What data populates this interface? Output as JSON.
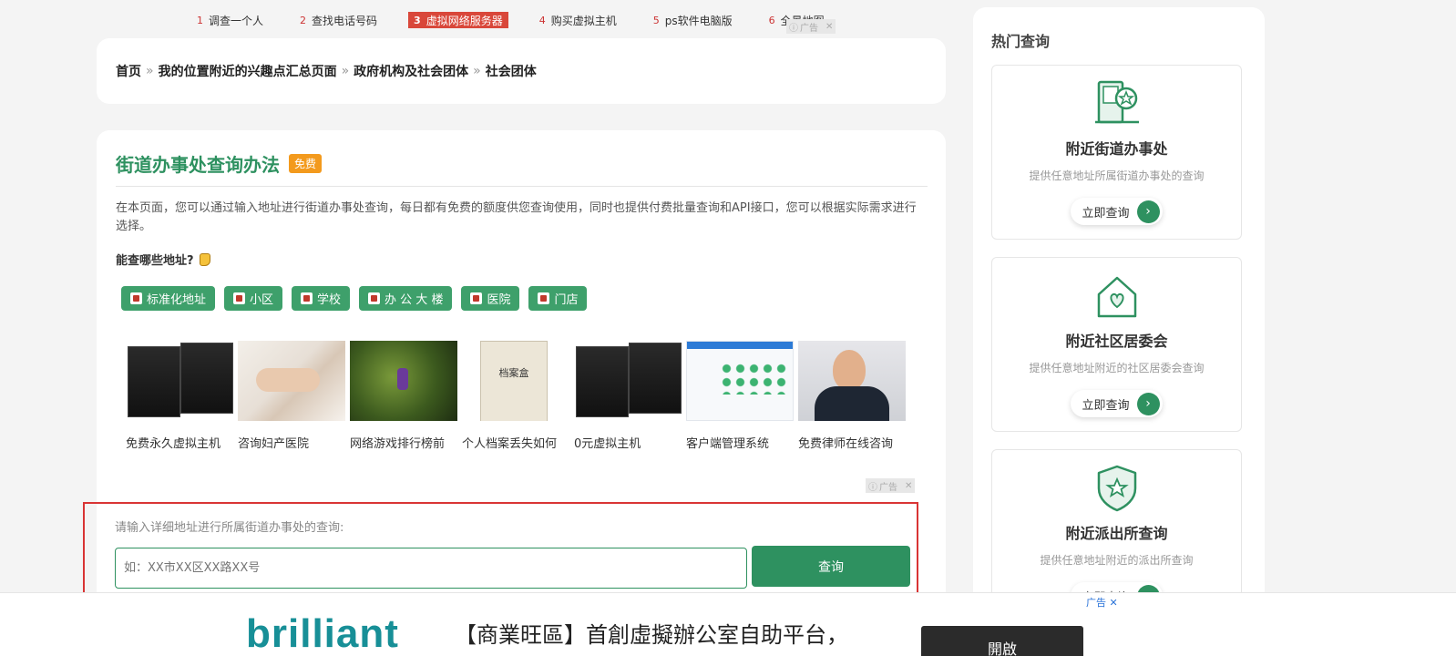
{
  "top_links": [
    {
      "num": "1",
      "label": "调查一个人"
    },
    {
      "num": "2",
      "label": "查找电话号码"
    },
    {
      "num": "3",
      "label": "虚拟网络服务器"
    },
    {
      "num": "4",
      "label": "购买虚拟主机"
    },
    {
      "num": "5",
      "label": "ps软件电脑版"
    },
    {
      "num": "6",
      "label": "全景地图"
    }
  ],
  "ad_tag": {
    "label": "广告",
    "close": "✕"
  },
  "breadcrumb": {
    "items": [
      "首页",
      "我的位置附近的兴趣点汇总页面",
      "政府机构及社会团体",
      "社会团体"
    ],
    "separator": "»"
  },
  "main": {
    "title": "街道办事处查询办法",
    "badge": "免费",
    "description": "在本页面，您可以通过输入地址进行街道办事处查询，每日都有免费的额度供您查询使用，同时也提供付费批量查询和API接口，您可以根据实际需求进行选择。",
    "subheading": "能查哪些地址?",
    "tags": [
      "标准化地址",
      "小区",
      "学校",
      "办 公 大 楼",
      "医院",
      "门店"
    ],
    "ads": [
      {
        "caption": "免费永久虚拟主机",
        "image": "server"
      },
      {
        "caption": "咨询妇产医院",
        "image": "bed"
      },
      {
        "caption": "网络游戏排行榜前",
        "image": "game"
      },
      {
        "caption": "个人档案丢失如何",
        "image": "folder"
      },
      {
        "caption": "0元虚拟主机",
        "image": "server"
      },
      {
        "caption": "客户端管理系统",
        "image": "app"
      },
      {
        "caption": "免费律师在线咨询",
        "image": "lawyer"
      }
    ]
  },
  "search": {
    "label": "请输入详细地址进行所属街道办事处的查询:",
    "placeholder": "如：XX市XX区XX路XX号",
    "button": "查询"
  },
  "sidebar": {
    "title": "热门查询",
    "items": [
      {
        "name": "附近街道办事处",
        "desc": "提供任意地址所属街道办事处的查询",
        "button": "立即查询",
        "icon": "building-star-icon"
      },
      {
        "name": "附近社区居委会",
        "desc": "提供任意地址附近的社区居委会查询",
        "button": "立即查询",
        "icon": "house-heart-icon"
      },
      {
        "name": "附近派出所查询",
        "desc": "提供任意地址附近的派出所查询",
        "button": "立即查询",
        "icon": "shield-star-icon"
      }
    ]
  },
  "banner": {
    "logo": "brilliant",
    "text": "【商業旺區】首創虛擬辦公室自助平台，",
    "button": "開啟",
    "ad_label": "广告 ✕"
  },
  "colors": {
    "accent": "#2e9160",
    "badge": "#f39a1d",
    "active_link": "#d9473a",
    "highlight_border": "#d93434"
  }
}
